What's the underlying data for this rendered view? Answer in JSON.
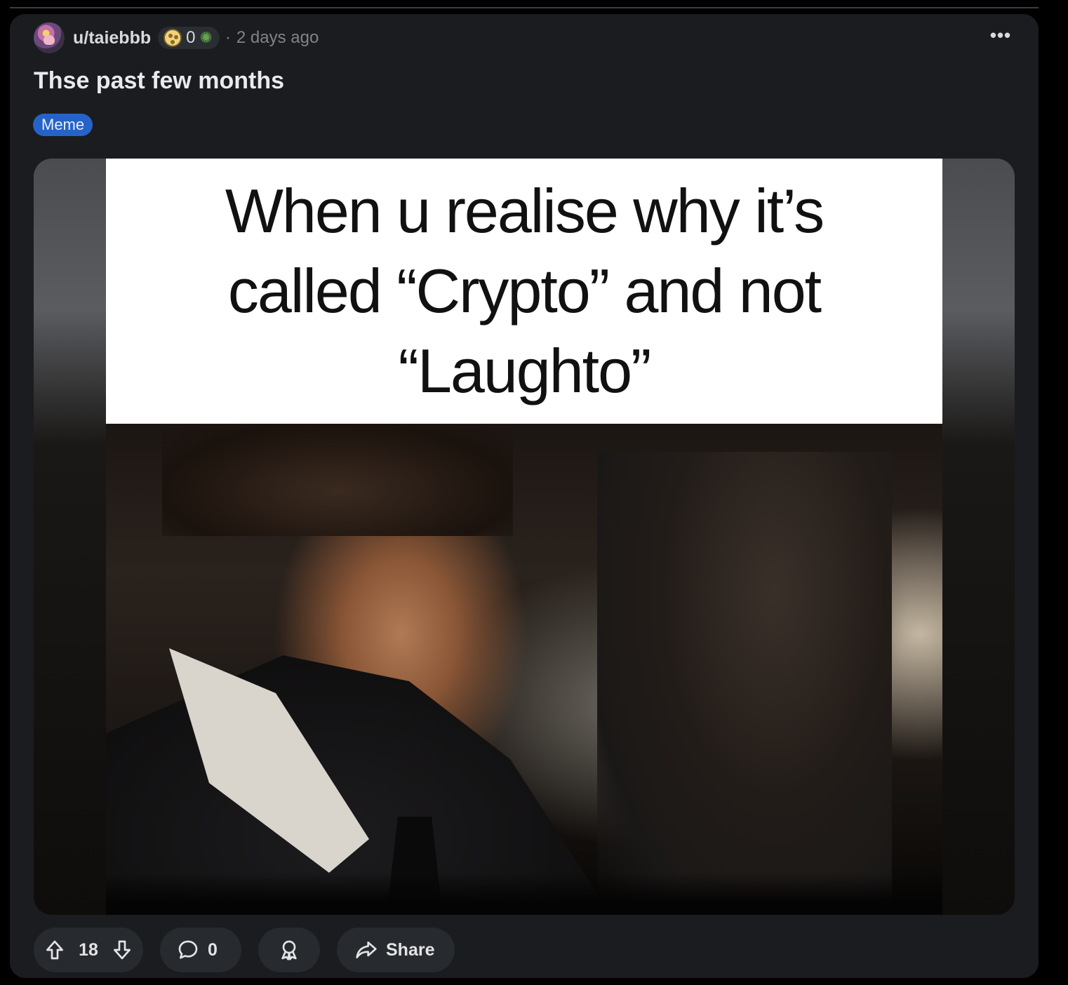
{
  "post": {
    "username": "u/taiebbb",
    "karma": "0",
    "timestamp": "2 days ago",
    "separator": "·",
    "title": "Thse past few months",
    "flair": "Meme",
    "more_label": "•••"
  },
  "media": {
    "caption": "When u realise why it’s\ncalled “Crypto” and not\n“Laughto”"
  },
  "actions": {
    "vote_count": "18",
    "comment_count": "0",
    "share_label": "Share"
  },
  "colors": {
    "card_bg": "#1a1c1f",
    "pill_bg": "#272a2e",
    "flair_bg": "#2563c9"
  },
  "icons": {
    "avatar": "user-avatar",
    "karma": "coin-icon",
    "badge": "virus-icon",
    "more": "more-options-icon",
    "upvote": "upvote-arrow-icon",
    "downvote": "downvote-arrow-icon",
    "comment": "comment-bubble-icon",
    "award": "award-icon",
    "share": "share-arrow-icon"
  }
}
